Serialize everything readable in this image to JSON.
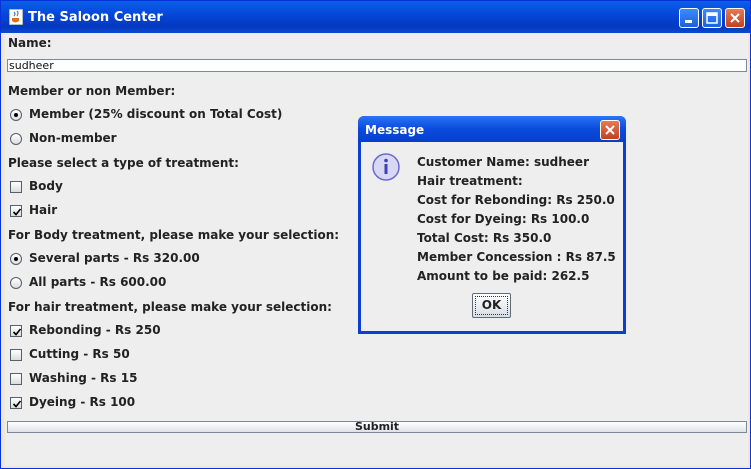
{
  "window": {
    "title": "The Saloon Center"
  },
  "form": {
    "name_label": "Name:",
    "name_value": "sudheer",
    "membership_label": "Member or non Member:",
    "member_option": "Member (25% discount on Total Cost)",
    "nonmember_option": "Non-member",
    "treatment_label": "Please select a type of treatment:",
    "body_option": "Body",
    "hair_option": "Hair",
    "body_treatment_label": "For Body treatment, please make your selection:",
    "several_parts_option": "Several parts - Rs 320.00",
    "all_parts_option": "All parts - Rs 600.00",
    "hair_treatment_label": "For hair treatment, please make your selection:",
    "rebonding_option": "Rebonding - Rs 250",
    "cutting_option": "Cutting - Rs 50",
    "washing_option": "Washing - Rs 15",
    "dyeing_option": "Dyeing - Rs 100",
    "submit_label": "Submit"
  },
  "dialog": {
    "title": "Message",
    "lines": [
      "Customer Name: sudheer",
      "Hair treatment:",
      "Cost for Rebonding: Rs 250.0",
      "Cost for Dyeing: Rs 100.0",
      "Total Cost: Rs 350.0",
      "Member Concession : Rs 87.5",
      "Amount to be paid: 262.5"
    ],
    "ok_label": "OK"
  },
  "colors": {
    "titlebar": "#0646d6",
    "panel": "#eeeeee",
    "info_icon": "#6a6ad0"
  },
  "icons": {
    "app": "java-cup-icon",
    "minimize": "minimize-icon",
    "maximize": "maximize-icon",
    "close": "close-icon",
    "info": "info-icon"
  }
}
